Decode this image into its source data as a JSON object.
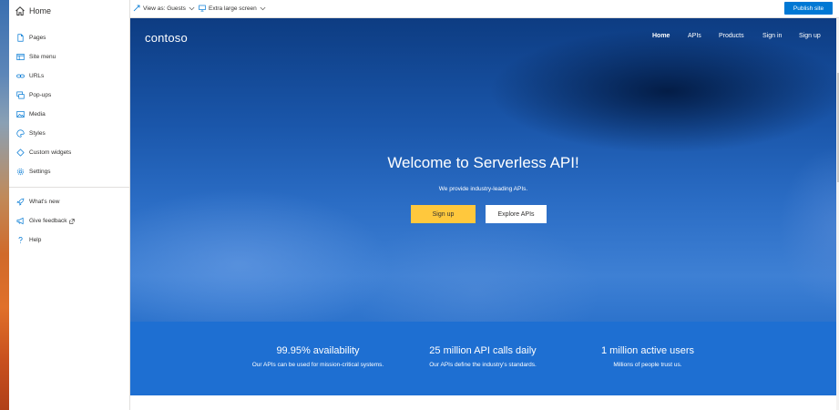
{
  "sidebar": {
    "home_label": "Home",
    "items": [
      {
        "label": "Pages",
        "icon": "page-icon"
      },
      {
        "label": "Site menu",
        "icon": "site-menu-icon"
      },
      {
        "label": "URLs",
        "icon": "link-icon"
      },
      {
        "label": "Pop-ups",
        "icon": "popup-icon"
      },
      {
        "label": "Media",
        "icon": "media-icon"
      },
      {
        "label": "Styles",
        "icon": "styles-icon"
      },
      {
        "label": "Custom widgets",
        "icon": "widget-icon"
      },
      {
        "label": "Settings",
        "icon": "gear-icon"
      }
    ],
    "secondary": [
      {
        "label": "What's new",
        "icon": "rocket-icon"
      },
      {
        "label": "Give feedback",
        "icon": "megaphone-icon"
      },
      {
        "label": "Help",
        "icon": "question-icon"
      }
    ]
  },
  "toolbar": {
    "view_as": "View as: Guests",
    "screen_size": "Extra large screen",
    "publish_label": "Publish site"
  },
  "site": {
    "logo": "contoso",
    "nav": [
      "Home",
      "APIs",
      "Products",
      "Sign in",
      "Sign up"
    ],
    "active_nav": "Home",
    "hero_title": "Welcome to Serverless API!",
    "hero_subtitle": "We provide industry-leading APIs.",
    "signup_button": "Sign up",
    "explore_button": "Explore APIs",
    "stats": [
      {
        "heading": "99.95% availability",
        "text": "Our APIs can be used for mission-critical systems."
      },
      {
        "heading": "25 million API calls daily",
        "text": "Our APIs define the industry's standards."
      },
      {
        "heading": "1 million active users",
        "text": "Millions of people trust us."
      }
    ]
  },
  "colors": {
    "accent": "#0078d4",
    "signup_button": "#ffc83d",
    "stats_band": "#1e6fd2"
  }
}
